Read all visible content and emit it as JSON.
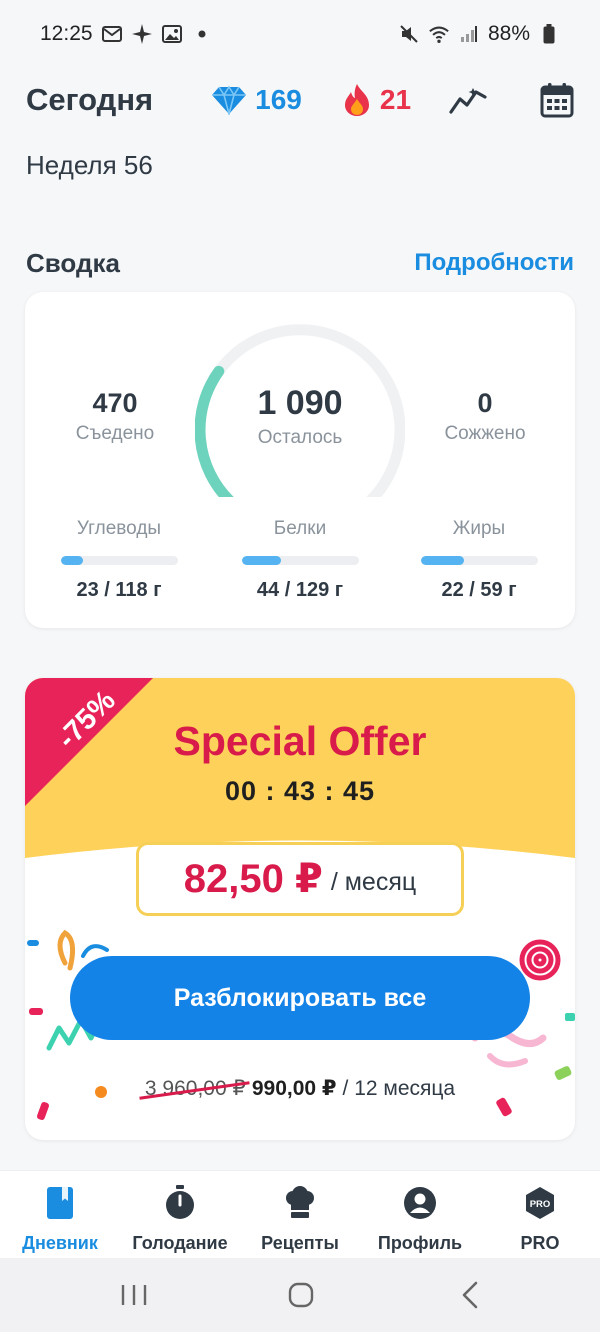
{
  "status_bar": {
    "time": "12:25",
    "battery": "88%"
  },
  "header": {
    "title": "Сегодня",
    "gems": "169",
    "streak": "21"
  },
  "week": "Неделя 56",
  "summary": {
    "title": "Сводка",
    "details_link": "Подробности",
    "eaten_value": "470",
    "eaten_label": "Съедено",
    "remaining_value": "1 090",
    "remaining_label": "Осталось",
    "burned_value": "0",
    "burned_label": "Сожжено",
    "calorie_progress": 0.3,
    "macros": [
      {
        "label": "Углеводы",
        "value": "23 / 118 г",
        "progress": 0.195
      },
      {
        "label": "Белки",
        "value": "44 / 129 г",
        "progress": 0.341
      },
      {
        "label": "Жиры",
        "value": "22 / 59 г",
        "progress": 0.373
      }
    ]
  },
  "offer": {
    "discount": "-75%",
    "title": "Special Offer",
    "timer": "00 : 43 : 45",
    "price": "82,50 ₽",
    "per": "/ месяц",
    "button": "Разблокировать все",
    "old_price": "3 960,00 ₽",
    "new_price": "990,00 ₽",
    "period": "/ 12 месяца"
  },
  "bottom_nav": [
    {
      "label": "Дневник",
      "icon": "diary-icon",
      "active": true
    },
    {
      "label": "Голодание",
      "icon": "stopwatch-icon",
      "active": false
    },
    {
      "label": "Рецепты",
      "icon": "chef-hat-icon",
      "active": false
    },
    {
      "label": "Профиль",
      "icon": "profile-icon",
      "active": false
    },
    {
      "label": "PRO",
      "icon": "pro-badge-icon",
      "active": false
    }
  ],
  "colors": {
    "accent_blue": "#1a8de0",
    "streak_red": "#e8334a",
    "offer_red": "#d81b4a",
    "offer_yellow": "#fdd15a",
    "gauge_teal": "#6dd3bd"
  }
}
